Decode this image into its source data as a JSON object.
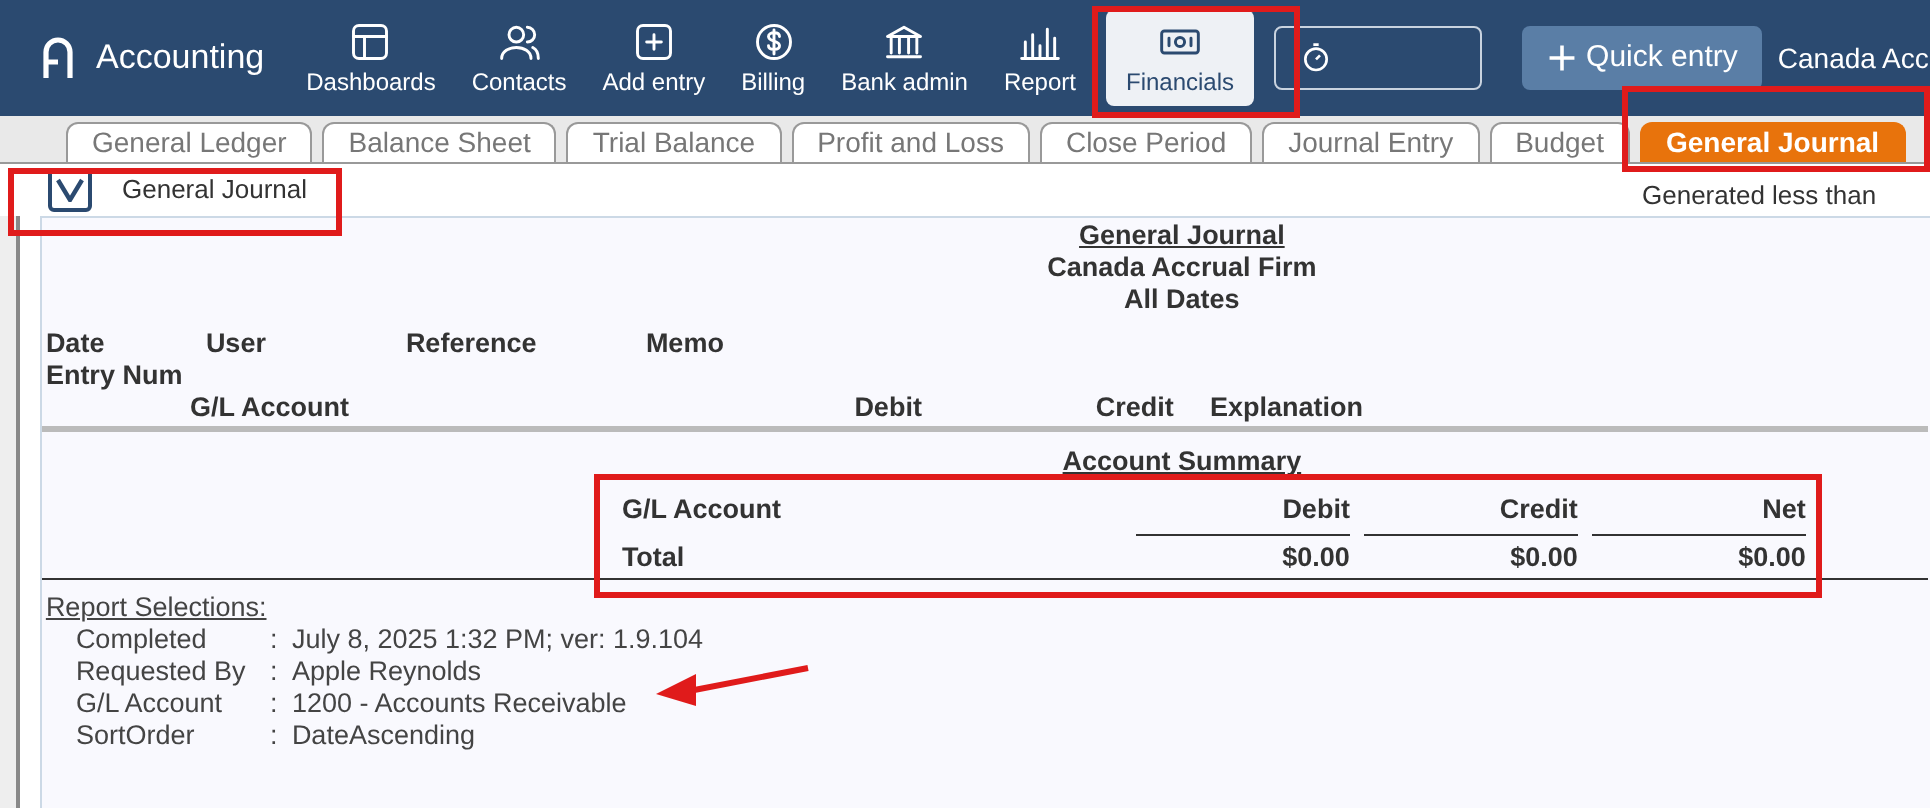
{
  "app": {
    "name": "Accounting"
  },
  "nav": [
    {
      "label": "Dashboards",
      "selected": false
    },
    {
      "label": "Contacts",
      "selected": false
    },
    {
      "label": "Add entry",
      "selected": false
    },
    {
      "label": "Billing",
      "selected": false
    },
    {
      "label": "Bank admin",
      "selected": false
    },
    {
      "label": "Report",
      "selected": false
    },
    {
      "label": "Financials",
      "selected": true
    }
  ],
  "quick_entry": "Quick entry",
  "company": "Canada Acc",
  "tabs": [
    {
      "label": "General Ledger",
      "selected": false
    },
    {
      "label": "Balance Sheet",
      "selected": false
    },
    {
      "label": "Trial Balance",
      "selected": false
    },
    {
      "label": "Profit and Loss",
      "selected": false
    },
    {
      "label": "Close Period",
      "selected": false
    },
    {
      "label": "Journal Entry",
      "selected": false
    },
    {
      "label": "Budget",
      "selected": false
    },
    {
      "label": "General Journal",
      "selected": true
    }
  ],
  "report_panel": {
    "title": "General Journal",
    "generated": "Generated less than"
  },
  "report": {
    "title": "General Journal",
    "company": "Canada Accrual Firm",
    "period": "All Dates",
    "header_rows": [
      [
        "Date",
        "User",
        "Reference",
        "Memo"
      ],
      [
        "Entry Num"
      ],
      [
        "G/L Account",
        "Debit",
        "Credit",
        "Explanation"
      ]
    ],
    "summary": {
      "title": "Account Summary",
      "columns": [
        "G/L Account",
        "Debit",
        "Credit",
        "Net"
      ],
      "rows": [
        [
          "Total",
          "$0.00",
          "$0.00",
          "$0.00"
        ]
      ]
    },
    "selections": {
      "title": "Report Selections:",
      "items": [
        {
          "label": "Completed",
          "separator": ":",
          "value": "July 8, 2025 1:32 PM; ver: 1.9.104"
        },
        {
          "label": "Requested By",
          "separator": ":",
          "value": "Apple Reynolds"
        },
        {
          "label": "G/L Account",
          "separator": ":",
          "value": "1200 - Accounts Receivable"
        },
        {
          "label": "SortOrder",
          "separator": ":",
          "value": "DateAscending"
        }
      ]
    }
  }
}
